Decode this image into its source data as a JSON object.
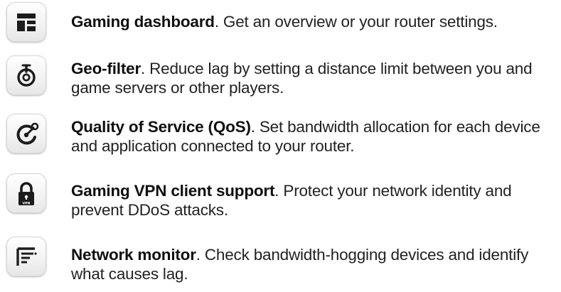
{
  "features": [
    {
      "icon": "dashboard-icon",
      "title": "Gaming dashboard",
      "description": ". Get an overview or your router settings."
    },
    {
      "icon": "geo-filter-icon",
      "title": "Geo-filter",
      "description": ".  Reduce lag by setting a distance limit between you and game servers or other players."
    },
    {
      "icon": "qos-icon",
      "title": "Quality of Service (QoS)",
      "description": ". Set bandwidth allocation for each device and application connected to your router."
    },
    {
      "icon": "vpn-lock-icon",
      "icon_label": "VPN",
      "title": "Gaming VPN client support",
      "description": ". Protect your network identity and prevent DDoS attacks."
    },
    {
      "icon": "network-monitor-icon",
      "title": "Network monitor",
      "description": ". Check bandwidth-hogging devices and identify what causes lag."
    }
  ],
  "colors": {
    "icon_glyph": "#1c1c1c",
    "text": "#222222",
    "tile_border": "#d6d6d6"
  }
}
